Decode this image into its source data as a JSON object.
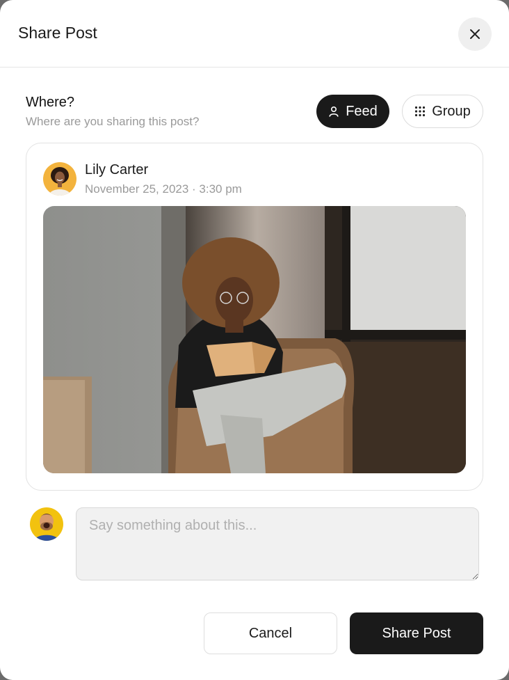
{
  "dialog": {
    "title": "Share Post",
    "close_icon": "close-icon"
  },
  "where": {
    "title": "Where?",
    "subtitle": "Where are you sharing this post?",
    "options": [
      {
        "label": "Feed",
        "icon": "user-icon",
        "selected": true
      },
      {
        "label": "Group",
        "icon": "grid-icon",
        "selected": false
      }
    ]
  },
  "post": {
    "author": "Lily Carter",
    "date": "November 25, 2023 · 3:30 pm",
    "image_subject": "woman-reading-in-wicker-chair"
  },
  "comment": {
    "placeholder": "Say something about this...",
    "value": ""
  },
  "actions": {
    "cancel_label": "Cancel",
    "share_label": "Share Post"
  },
  "colors": {
    "primary": "#1a1a1a",
    "muted_text": "#9a9a9a",
    "border": "#e2e2e2"
  }
}
